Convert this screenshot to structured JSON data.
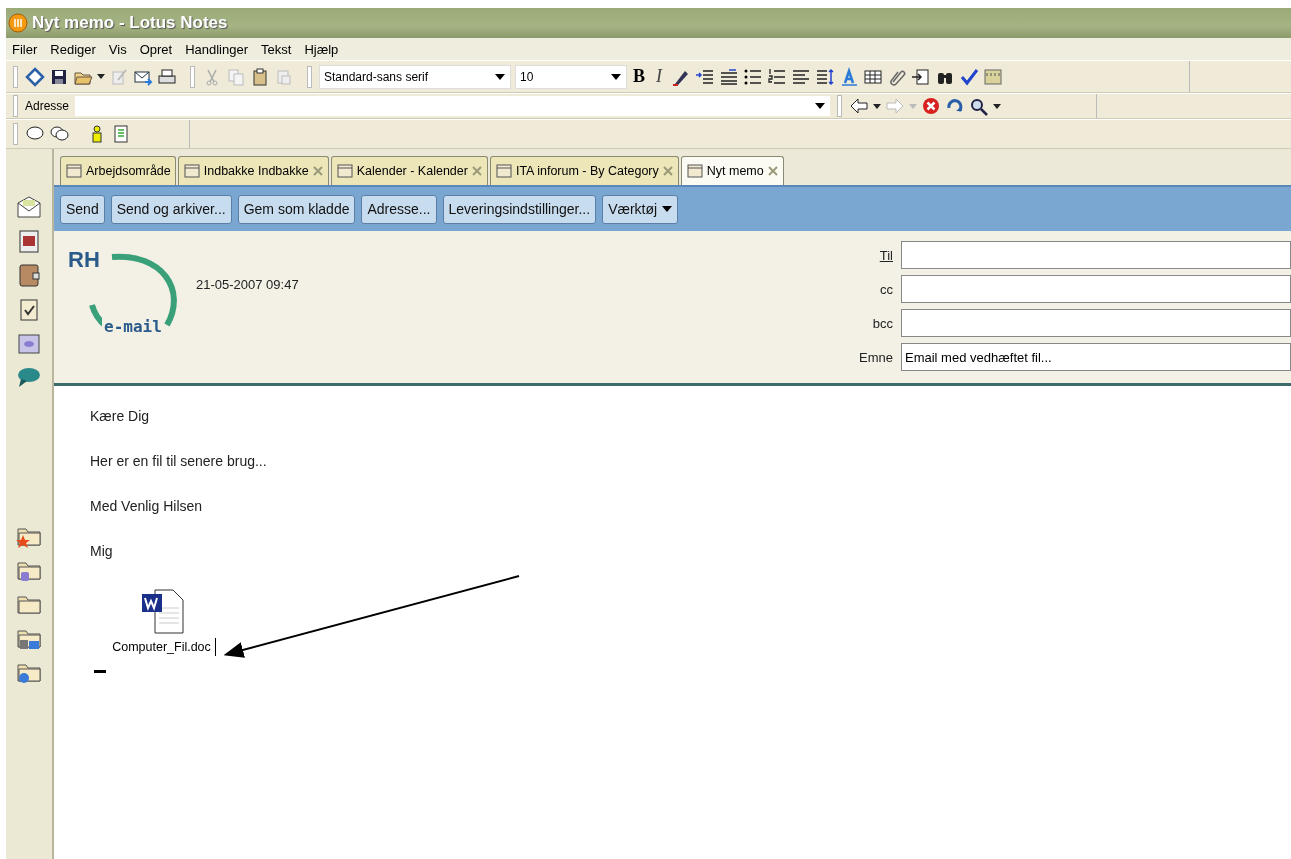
{
  "window": {
    "title": "Nyt memo - Lotus Notes"
  },
  "menu": [
    "Filer",
    "Rediger",
    "Vis",
    "Opret",
    "Handlinger",
    "Tekst",
    "Hjælp"
  ],
  "format_bar": {
    "font": "Standard-sans serif",
    "size": "10",
    "bold": "B",
    "italic": "I"
  },
  "address_bar": {
    "label": "Adresse"
  },
  "tabs": [
    {
      "label": "Arbejdsområde",
      "selected": false,
      "closable": false
    },
    {
      "label": "Indbakke Indbakke",
      "selected": false,
      "closable": true
    },
    {
      "label": "Kalender - Kalender",
      "selected": false,
      "closable": true
    },
    {
      "label": "ITA inforum - By Category",
      "selected": false,
      "closable": true
    },
    {
      "label": "Nyt memo",
      "selected": true,
      "closable": true
    }
  ],
  "actions": [
    {
      "label": "Send",
      "dropdown": false
    },
    {
      "label": "Send og arkiver...",
      "dropdown": false
    },
    {
      "label": "Gem som kladde",
      "dropdown": false
    },
    {
      "label": "Adresse...",
      "dropdown": false
    },
    {
      "label": "Leveringsindstillinger...",
      "dropdown": false
    },
    {
      "label": "Værktøj",
      "dropdown": true
    }
  ],
  "header": {
    "logo_top": "RH",
    "logo_bottom": "e-mail",
    "date": "21-05-2007 09:47",
    "fields": [
      {
        "label": "Til",
        "kind": "link"
      },
      {
        "label": "cc",
        "kind": "plain"
      },
      {
        "label": "bcc",
        "kind": "plain"
      },
      {
        "label": "Emne",
        "kind": "plain",
        "value": "Email med vedhæftet fil..."
      }
    ]
  },
  "body": {
    "paragraphs": [
      "Kære Dig",
      "Her er en fil til senere brug...",
      "Med Venlig Hilsen",
      "Mig"
    ],
    "attachment": {
      "filename": "Computer_Fil.doc"
    }
  }
}
